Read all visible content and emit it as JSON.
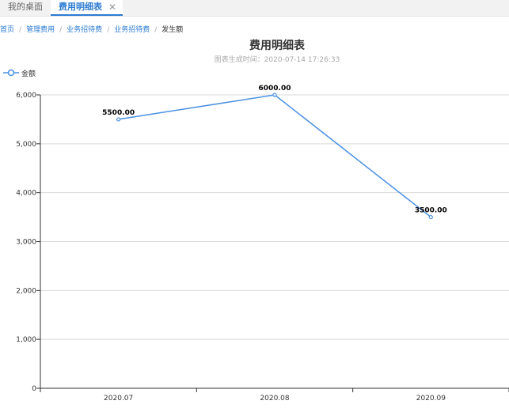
{
  "tabs": {
    "home_label": "我的桌面",
    "active_label": "费用明细表",
    "close_glyph": "✕"
  },
  "breadcrumb": [
    "首页",
    "管理费用",
    "业务招待费",
    "业务招待费",
    "发生额"
  ],
  "breadcrumb_separator": "/",
  "chart_data": {
    "type": "line",
    "title": "费用明细表",
    "subtitle": "图表生成时间：2020-07-14 17:26:33",
    "categories": [
      "2020.07",
      "2020.08",
      "2020.09"
    ],
    "series": [
      {
        "name": "金额",
        "values": [
          5500,
          6000,
          3500
        ],
        "labels": [
          "5500.00",
          "6000.00",
          "3500.00"
        ],
        "color": "#4a90e2"
      }
    ],
    "ylim": [
      0,
      6000
    ],
    "yticks": [
      "0",
      "1,000",
      "2,000",
      "3,000",
      "4,000",
      "5,000",
      "6,000"
    ],
    "grid": true,
    "legend_position": "top-left"
  },
  "colors": {
    "accent": "#2b7bd3",
    "line": "#4a90e2"
  }
}
